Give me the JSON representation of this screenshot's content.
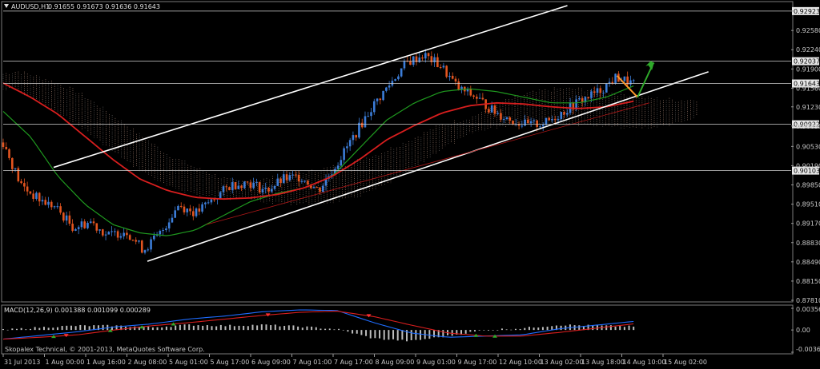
{
  "header": {
    "symbol": "AUDUSD,H1",
    "ohlc": "0.91655 0.91673 0.91636 0.91643"
  },
  "footer": {
    "copyright": "Skopalex Technical, © 2001-2013, MetaQuotes Software Corp."
  },
  "colors": {
    "background": "#000000",
    "bull": "#3c7dd8",
    "bear": "#e2541f",
    "ma_slow": "#d81e1e",
    "ma_fast": "#1f9a1f",
    "cloud": "#c8a08c",
    "channel": "#ffffff",
    "forecast_down": "#ff9a2a",
    "forecast_up": "#2faa2a",
    "macd_line": "#1e6cff",
    "signal_line": "#d81e1e"
  },
  "icons": {
    "forecast_arrow": "arrow-up-right-icon",
    "signal_up": "up-arrow-icon",
    "signal_down": "down-arrow-icon"
  },
  "chart_data": [
    {
      "type": "line",
      "title": "AUDUSD,H1",
      "y_ticks": [
        "0.92923",
        "0.92580",
        "0.92240",
        "0.91900",
        "0.91560",
        "0.91230",
        "0.90890",
        "0.90530",
        "0.90190",
        "0.89850",
        "0.89510",
        "0.89170",
        "0.88830",
        "0.88490",
        "0.88150",
        "0.87810"
      ],
      "ylim": [
        0.8781,
        0.9302
      ],
      "price_tags": [
        "0.92923",
        "0.92037",
        "0.91643",
        "0.90922",
        "0.90103"
      ],
      "x_ticks": [
        "31 Jul 2013",
        "1 Aug 00:00",
        "1 Aug 16:00",
        "2 Aug 08:00",
        "5 Aug 01:00",
        "5 Aug 17:00",
        "6 Aug 09:00",
        "7 Aug 01:00",
        "7 Aug 17:00",
        "8 Aug 09:00",
        "9 Aug 01:00",
        "9 Aug 17:00",
        "12 Aug 10:00",
        "13 Aug 02:00",
        "13 Aug 18:00",
        "14 Aug 10:00",
        "15 Aug 02:00"
      ],
      "close_anchors": [
        0.906,
        0.8985,
        0.896,
        0.8945,
        0.891,
        0.892,
        0.8895,
        0.8905,
        0.887,
        0.89,
        0.895,
        0.8935,
        0.896,
        0.8985,
        0.899,
        0.8975,
        0.8995,
        0.9,
        0.8975,
        0.902,
        0.907,
        0.912,
        0.916,
        0.92,
        0.9215,
        0.9195,
        0.9155,
        0.914,
        0.9115,
        0.91,
        0.909,
        0.9095,
        0.9115,
        0.9135,
        0.915,
        0.9175,
        0.9164
      ],
      "ma_slow_anchors": [
        0.9165,
        0.914,
        0.911,
        0.907,
        0.903,
        0.8995,
        0.8975,
        0.8963,
        0.896,
        0.8962,
        0.8968,
        0.898,
        0.9,
        0.903,
        0.9065,
        0.909,
        0.9112,
        0.9125,
        0.913,
        0.9128,
        0.9123,
        0.912,
        0.9123,
        0.9133
      ],
      "ma_fast_anchors": [
        0.9115,
        0.907,
        0.9,
        0.895,
        0.8915,
        0.89,
        0.8895,
        0.8905,
        0.893,
        0.8955,
        0.897,
        0.898,
        0.9,
        0.905,
        0.91,
        0.913,
        0.915,
        0.9155,
        0.915,
        0.914,
        0.913,
        0.913,
        0.914,
        0.916
      ],
      "channel": {
        "upper": [
          [
            0.9016,
            0.064
          ],
          [
            0.9302,
            0.716
          ]
        ],
        "lower": [
          [
            0.885,
            0.183
          ],
          [
            0.9185,
            0.895
          ]
        ],
        "middle": [
          [
            0.8915,
            0.258
          ],
          [
            0.913,
            0.82
          ]
        ]
      },
      "forecast": {
        "down": [
          [
            0.9178,
            0.779
          ],
          [
            0.914,
            0.805
          ]
        ],
        "up": [
          [
            0.914,
            0.805
          ],
          [
            0.92,
            0.825
          ]
        ]
      }
    },
    {
      "type": "bar",
      "title": "MACD(12,26,9) 0.001388 0.001099 0.000289",
      "y_ticks": [
        "0.003562",
        "0.00",
        "-0.003657"
      ],
      "ylim": [
        -0.003657,
        0.003562
      ],
      "macd_anchors": [
        -0.0015,
        -0.0009,
        -0.0003,
        0.0005,
        0.001,
        0.0018,
        0.0023,
        0.003,
        0.0033,
        0.0032,
        0.0012,
        -0.0005,
        -0.0012,
        -0.001,
        -0.0008,
        0.0002,
        0.0008,
        0.0014
      ],
      "signal_anchors": [
        -0.0015,
        -0.0012,
        -0.0008,
        0.0,
        0.0007,
        0.0012,
        0.0018,
        0.0024,
        0.0029,
        0.0031,
        0.0022,
        0.0008,
        -0.0005,
        -0.001,
        -0.001,
        -0.0004,
        0.0003,
        0.001
      ]
    }
  ]
}
